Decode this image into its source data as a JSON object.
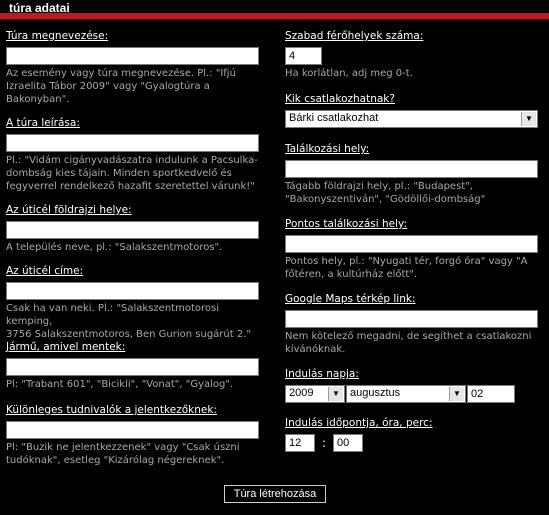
{
  "header": {
    "title": "túra adatai",
    "accent_color": "#c4161c"
  },
  "left": {
    "name": {
      "label": "Túra megnevezése:",
      "value": "",
      "hint": "Az esemény vagy túra megnevezése. Pl.: \"Ifjú\nIzraelita Tábor 2009\" vagy \"Gyalogtúra a\nBakonyban\"."
    },
    "description": {
      "label": "A túra leírása:",
      "value": "",
      "hint": "Pl.: \"Vidám cigányvadászatra indulunk a Pacsulka-\ndombság kies tájain. Minden sportkedvelő és\nfegyverrel rendelkező hazafit szeretettel várunk!\""
    },
    "destination": {
      "label": "Az úticél földrajzi helye:",
      "value": "",
      "hint": "A település neve, pl.: \"Salakszentmotoros\"."
    },
    "address": {
      "label": "Az úticél címe:",
      "value": "",
      "hint": "Csak ha van neki. Pl.: \"Salakszentmotorosi kemping,\n3756 Salakszentmotoros, Ben Gurion sugárút 2.\""
    },
    "vehicle": {
      "label": "Jármű, amivel mentek:",
      "value": "",
      "hint": "Pl: \"Trabant 601\", \"Bicikli\", \"Vonat\", \"Gyalog\"."
    },
    "notes": {
      "label": "Különleges tudnivalók a jelentkezőknek:",
      "value": "",
      "hint": "Pl: \"Buzik ne jelentkezzenek\" vagy \"Csak úszni\ntudóknak\", esetleg \"Kizárólag négereknek\"."
    }
  },
  "right": {
    "seats": {
      "label": "Szabad férőhelyek száma:",
      "value": "4",
      "hint": "Ha korlátlan, adj meg 0-t."
    },
    "who": {
      "label": "Kik csatlakozhatnak?",
      "selected": "Bárki csatlakozhat"
    },
    "meeting": {
      "label": "Találkozási hely:",
      "value": "",
      "hint": "Tágabb földrajzi hely, pl.: \"Budapest\",\n\"Bakonyszentiván\", \"Gödöllői-dombság\""
    },
    "exact_meeting": {
      "label": "Pontos találkozási hely:",
      "value": "",
      "hint": "Pontos hely, pl.: \"Nyugati tér, forgó óra\" vagy \"A\nfőtéren, a kultúrház előtt\"."
    },
    "maps": {
      "label": "Google Maps térkép link:",
      "value": "",
      "hint": "Nem kötelező megadni, de segíthet a csatlakozni\nkívánóknak."
    },
    "start_date": {
      "label": "Indulás napja:",
      "year": "2009",
      "month": "augusztus",
      "day": "02"
    },
    "start_time": {
      "label": "Indulás időpontja, óra, perc:",
      "hour": "12",
      "separator": ":",
      "minute": "00"
    }
  },
  "submit_label": "Túra létrehozása"
}
